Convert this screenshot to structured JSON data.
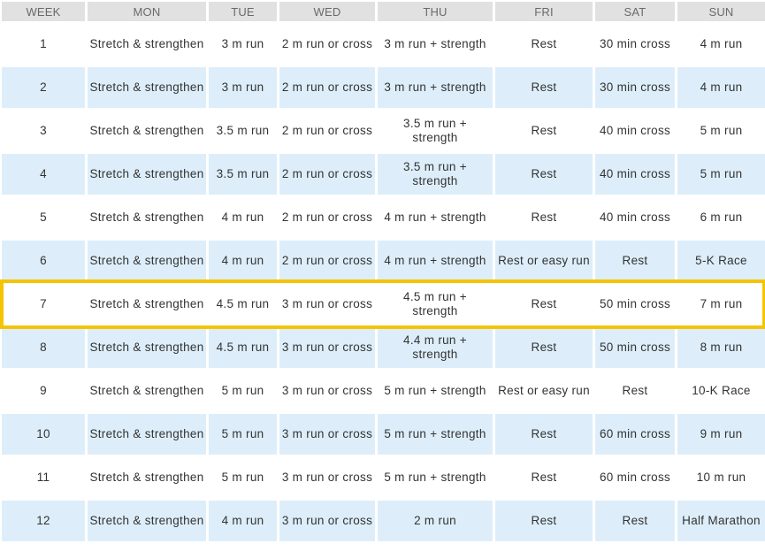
{
  "colors": {
    "header_bg": "#e1e1e1",
    "header_text": "#6a6a6a",
    "row_white": "#ffffff",
    "row_blue": "#ddeefa",
    "highlight": "#f5c400",
    "cell_text": "#333333"
  },
  "headers": [
    "WEEK",
    "MON",
    "TUE",
    "WED",
    "THU",
    "FRI",
    "SAT",
    "SUN"
  ],
  "highlighted_week": "7",
  "rows": [
    {
      "week": "1",
      "mon": "Stretch & strengthen",
      "tue": "3 m run",
      "wed": "2 m run or cross",
      "thu": "3 m run + strength",
      "fri": "Rest",
      "sat": "30 min cross",
      "sun": "4 m run"
    },
    {
      "week": "2",
      "mon": "Stretch & strengthen",
      "tue": "3 m run",
      "wed": "2 m run or cross",
      "thu": "3 m run + strength",
      "fri": "Rest",
      "sat": "30 min cross",
      "sun": "4 m run"
    },
    {
      "week": "3",
      "mon": "Stretch & strengthen",
      "tue": "3.5 m run",
      "wed": "2 m run or cross",
      "thu": "3.5 m run + strength",
      "fri": "Rest",
      "sat": "40 min cross",
      "sun": "5 m run"
    },
    {
      "week": "4",
      "mon": "Stretch & strengthen",
      "tue": "3.5 m run",
      "wed": "2 m run or cross",
      "thu": "3.5 m run + strength",
      "fri": "Rest",
      "sat": "40 min cross",
      "sun": "5 m run"
    },
    {
      "week": "5",
      "mon": "Stretch & strengthen",
      "tue": "4 m run",
      "wed": "2 m run or cross",
      "thu": "4 m run + strength",
      "fri": "Rest",
      "sat": "40 min cross",
      "sun": "6 m run"
    },
    {
      "week": "6",
      "mon": "Stretch & strengthen",
      "tue": "4 m run",
      "wed": "2 m run or cross",
      "thu": "4 m run + strength",
      "fri": "Rest or easy run",
      "sat": "Rest",
      "sun": "5-K Race"
    },
    {
      "week": "7",
      "mon": "Stretch & strengthen",
      "tue": "4.5 m run",
      "wed": "3 m run or cross",
      "thu": "4.5 m run + strength",
      "fri": "Rest",
      "sat": "50 min cross",
      "sun": "7 m run"
    },
    {
      "week": "8",
      "mon": "Stretch & strengthen",
      "tue": "4.5 m run",
      "wed": "3 m run or cross",
      "thu": "4.4 m run + strength",
      "fri": "Rest",
      "sat": "50 min cross",
      "sun": "8 m run"
    },
    {
      "week": "9",
      "mon": "Stretch & strengthen",
      "tue": "5 m run",
      "wed": "3 m run or cross",
      "thu": "5 m run + strength",
      "fri": "Rest or easy run",
      "sat": "Rest",
      "sun": "10-K Race"
    },
    {
      "week": "10",
      "mon": "Stretch & strengthen",
      "tue": "5 m run",
      "wed": "3 m run or cross",
      "thu": "5 m run + strength",
      "fri": "Rest",
      "sat": "60 min cross",
      "sun": "9 m run"
    },
    {
      "week": "11",
      "mon": "Stretch & strengthen",
      "tue": "5 m run",
      "wed": "3 m run or cross",
      "thu": "5 m run + strength",
      "fri": "Rest",
      "sat": "60 min cross",
      "sun": "10 m run"
    },
    {
      "week": "12",
      "mon": "Stretch & strengthen",
      "tue": "4 m run",
      "wed": "3 m run or cross",
      "thu": "2 m run",
      "fri": "Rest",
      "sat": "Rest",
      "sun": "Half Marathon"
    }
  ]
}
